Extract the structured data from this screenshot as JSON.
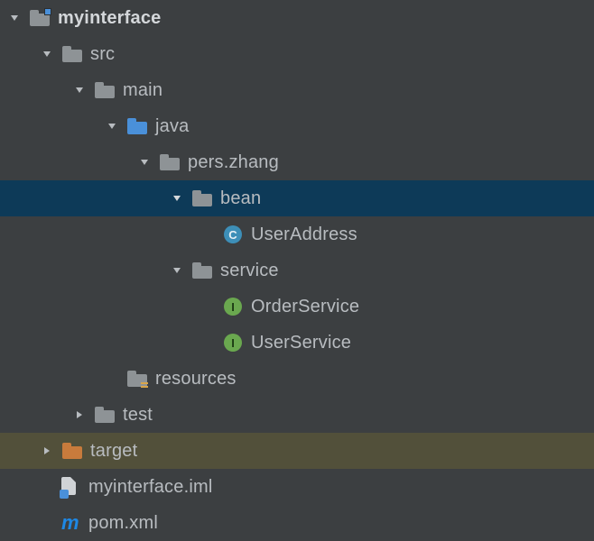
{
  "tree": {
    "myinterface": {
      "label": "myinterface"
    },
    "src": {
      "label": "src"
    },
    "main": {
      "label": "main"
    },
    "java": {
      "label": "java"
    },
    "pkg": {
      "label": "pers.zhang"
    },
    "bean": {
      "label": "bean"
    },
    "userAddress": {
      "label": "UserAddress",
      "badge": "C"
    },
    "service": {
      "label": "service"
    },
    "orderService": {
      "label": "OrderService",
      "badge": "I"
    },
    "userService": {
      "label": "UserService",
      "badge": "I"
    },
    "resources": {
      "label": "resources"
    },
    "test": {
      "label": "test"
    },
    "target": {
      "label": "target"
    },
    "iml": {
      "label": "myinterface.iml"
    },
    "pom": {
      "label": "pom.xml",
      "badge": "m"
    }
  }
}
